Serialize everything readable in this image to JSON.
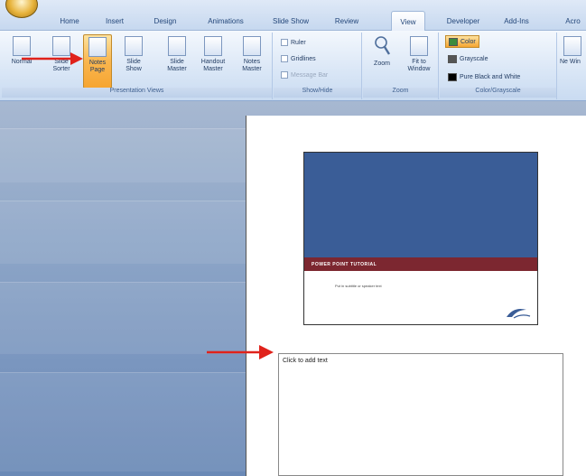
{
  "ribbon": {
    "tabs": [
      "Home",
      "Insert",
      "Design",
      "Animations",
      "Slide Show",
      "Review",
      "View",
      "Developer",
      "Add-Ins",
      "Acro"
    ],
    "active_tab": "View",
    "presentation_views": {
      "label": "Presentation Views",
      "buttons": [
        "Normal",
        "Slide Sorter",
        "Notes Page",
        "Slide Show",
        "Slide Master",
        "Handout Master",
        "Notes Master"
      ],
      "selected": "Notes Page"
    },
    "show_hide": {
      "label": "Show/Hide",
      "items": [
        {
          "text": "Ruler",
          "enabled": true
        },
        {
          "text": "Gridlines",
          "enabled": true
        },
        {
          "text": "Message Bar",
          "enabled": false
        }
      ]
    },
    "zoom": {
      "label": "Zoom",
      "buttons": [
        "Zoom",
        "Fit to Window"
      ]
    },
    "color_grayscale": {
      "label": "Color/Grayscale",
      "items": [
        {
          "text": "Color",
          "color": "#3d8b3d",
          "selected": true
        },
        {
          "text": "Grayscale",
          "color": "#555555",
          "selected": false
        },
        {
          "text": "Pure Black and White",
          "color": "#000000",
          "selected": false
        }
      ]
    },
    "window": {
      "label": "New Window",
      "short_label": "Ne Win"
    }
  },
  "notes_page": {
    "slide_title": "POWER POINT TUTORIAL",
    "slide_subtitle": "Put in subtitle or speaker text",
    "notes_placeholder": "Click to add text"
  },
  "colors": {
    "slide_blue": "#3a5d97",
    "slide_bar": "#7c2730",
    "selected_button": "#f9b64f",
    "arrow": "#e0221b"
  }
}
